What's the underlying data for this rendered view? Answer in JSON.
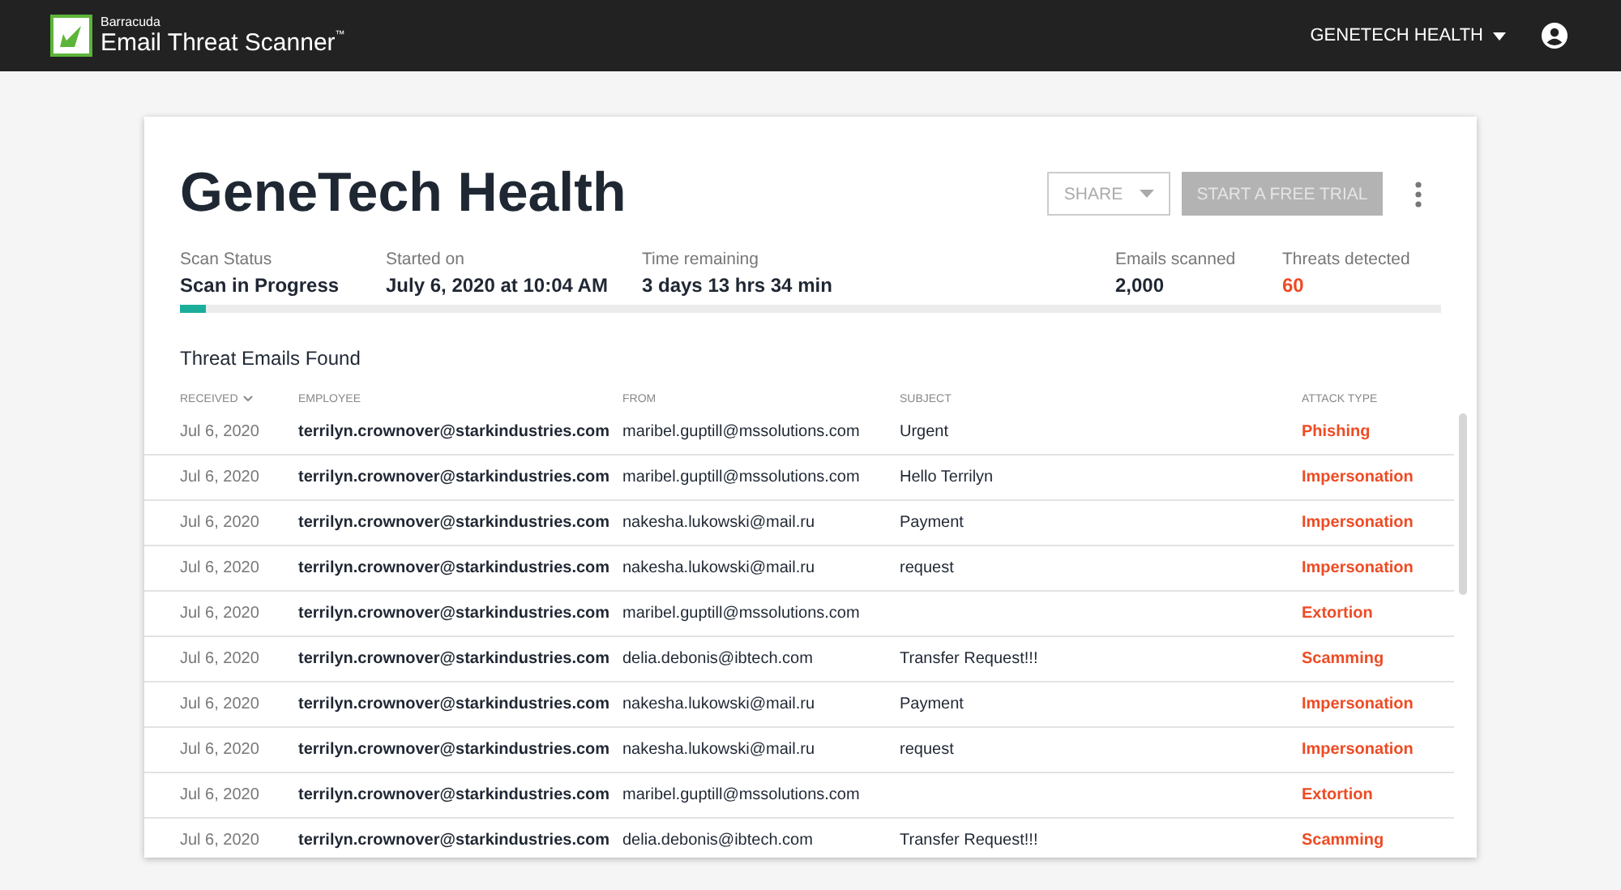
{
  "topbar": {
    "brand_small": "Barracuda",
    "brand": "Email Threat Scanner",
    "trademark": "™",
    "account": "GENETECH HEALTH"
  },
  "title": "GeneTech Health",
  "actions": {
    "share": "SHARE",
    "trial": "START A FREE TRIAL",
    "trial_disabled": true
  },
  "stats": [
    {
      "label": "Scan Status",
      "value": "Scan in Progress",
      "kind": "plain"
    },
    {
      "label": "Started on",
      "value": "July 6, 2020 at 10:04 AM",
      "kind": "plain"
    },
    {
      "label": "Time remaining",
      "value": "3 days 13 hrs 34 min",
      "kind": "plain"
    },
    {
      "label": "Emails scanned",
      "value": "2,000",
      "kind": "plain"
    },
    {
      "label": "Threats detected",
      "value": "60",
      "kind": "alert"
    }
  ],
  "progress": {
    "level": 0.02
  },
  "table": {
    "title": "Threat Emails Found",
    "columns": [
      "RECEIVED",
      "EMPLOYEE",
      "FROM",
      "SUBJECT",
      "ATTACK TYPE"
    ],
    "rows": [
      {
        "received": "Jul 6, 2020",
        "employee": "terrilyn.crownover@starkindustries.com",
        "from": "maribel.guptill@mssolutions.com",
        "subject": "Urgent",
        "attack_type": "Phishing"
      },
      {
        "received": "Jul 6, 2020",
        "employee": "terrilyn.crownover@starkindustries.com",
        "from": "maribel.guptill@mssolutions.com",
        "subject": "Hello Terrilyn",
        "attack_type": "Impersonation"
      },
      {
        "received": "Jul 6, 2020",
        "employee": "terrilyn.crownover@starkindustries.com",
        "from": "nakesha.lukowski@mail.ru",
        "subject": "Payment",
        "attack_type": "Impersonation"
      },
      {
        "received": "Jul 6, 2020",
        "employee": "terrilyn.crownover@starkindustries.com",
        "from": "nakesha.lukowski@mail.ru",
        "subject": "request",
        "attack_type": "Impersonation"
      },
      {
        "received": "Jul 6, 2020",
        "employee": "terrilyn.crownover@starkindustries.com",
        "from": "maribel.guptill@mssolutions.com",
        "attack_type": "Extortion"
      },
      {
        "received": "Jul 6, 2020",
        "employee": "terrilyn.crownover@starkindustries.com",
        "from": "delia.debonis@ibtech.com",
        "subject": "Transfer Request!!!",
        "attack_type": "Scamming"
      },
      {
        "received": "Jul 6, 2020",
        "employee": "terrilyn.crownover@starkindustries.com",
        "from": "nakesha.lukowski@mail.ru",
        "subject": "Payment",
        "attack_type": "Impersonation"
      },
      {
        "received": "Jul 6, 2020",
        "employee": "terrilyn.crownover@starkindustries.com",
        "from": "nakesha.lukowski@mail.ru",
        "subject": "request",
        "attack_type": "Impersonation"
      },
      {
        "received": "Jul 6, 2020",
        "employee": "terrilyn.crownover@starkindustries.com",
        "from": "maribel.guptill@mssolutions.com",
        "attack_type": "Extortion"
      },
      {
        "received": "Jul 6, 2020",
        "employee": "terrilyn.crownover@starkindustries.com",
        "from": "delia.debonis@ibtech.com",
        "subject": "Transfer Request!!!",
        "attack_type": "Scamming"
      }
    ]
  }
}
